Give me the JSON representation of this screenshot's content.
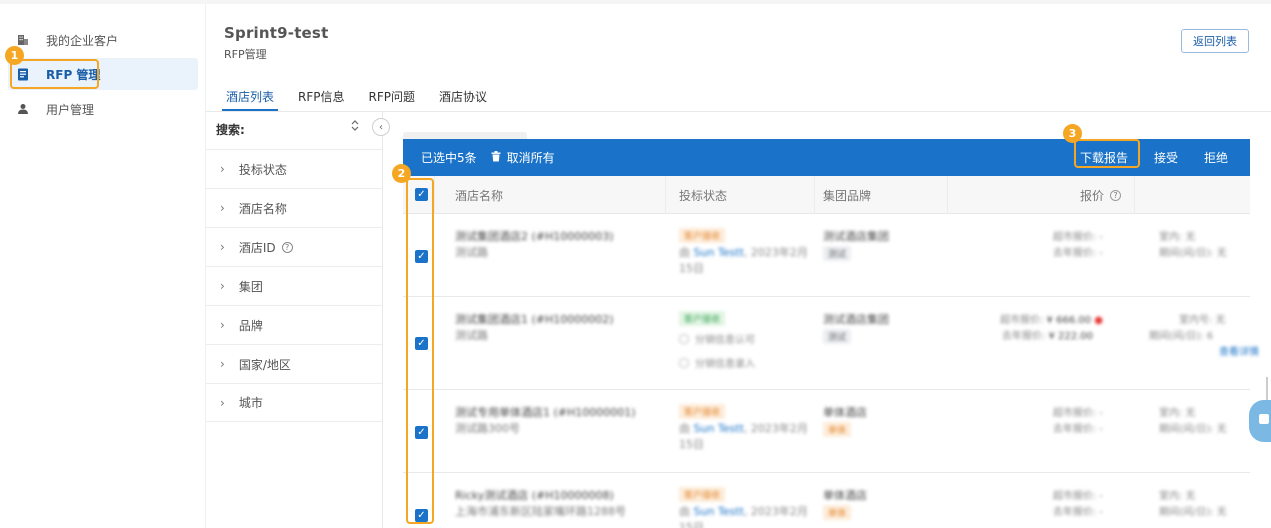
{
  "sidebar": {
    "items": [
      {
        "label": "我的企业客户",
        "icon": "building-icon"
      },
      {
        "label": "RFP 管理",
        "icon": "document-icon",
        "active": true
      },
      {
        "label": "用户管理",
        "icon": "user-icon"
      }
    ]
  },
  "header": {
    "title": "Sprint9-test",
    "subtitle": "RFP管理",
    "back_button": "返回列表"
  },
  "tabs": [
    {
      "label": "酒店列表",
      "active": true
    },
    {
      "label": "RFP信息"
    },
    {
      "label": "RFP问题"
    },
    {
      "label": "酒店协议"
    }
  ],
  "filter": {
    "title": "搜索:",
    "items": [
      {
        "label": "投标状态"
      },
      {
        "label": "酒店名称"
      },
      {
        "label": "酒店ID",
        "help": "?"
      },
      {
        "label": "集团"
      },
      {
        "label": "品牌"
      },
      {
        "label": "国家/地区"
      },
      {
        "label": "城市"
      }
    ]
  },
  "bulk_bar": {
    "selected_text": "已选中5条",
    "clear_label": "取消所有",
    "actions": {
      "download": "下载报告",
      "accept": "接受",
      "reject": "拒绝"
    }
  },
  "table": {
    "headers": {
      "name": "酒店名称",
      "status": "投标状态",
      "brand": "集团品牌",
      "price": "报价"
    },
    "rows": [
      {
        "name": "测试集团酒店2 (#H10000003)",
        "address": "测试路",
        "status": "客户接收",
        "status_style": "orange",
        "by_prefix": "由",
        "by_user": "Sun Testt",
        "by_date": ", 2023年2月",
        "by_date2": "15日",
        "group": "测试酒店集团",
        "brand_tag": "测试",
        "price1": "超市报价: -",
        "price2": "去年报价: -",
        "extra1": "室内: 无",
        "extra2": "期间(间/日): 无"
      },
      {
        "name": "测试集团酒店1 (#H10000002)",
        "address": "测试路",
        "status": "客户接收",
        "status_style": "green",
        "radio1": "分销信息认可",
        "radio2": "分销信息录入",
        "group": "测试酒店集团",
        "brand_tag": "测试",
        "price1_label": "超市报价:",
        "price1_value": "¥ 666.00",
        "price1_flag": "●",
        "price2_label": "去年报价:",
        "price2_value": "¥ 222.00",
        "extra1": "室内号: 无",
        "extra2": "期间(间/日): 6",
        "extra_link": "查看详情"
      },
      {
        "name": "测试专用单体酒店1 (#H10000001)",
        "address": "测试路300号",
        "status": "客户接收",
        "status_style": "orange",
        "by_prefix": "由",
        "by_user": "Sun Testt",
        "by_date": ", 2023年2月",
        "by_date2": "15日",
        "group": "单体酒店",
        "brand_tag": "单体",
        "price1": "超市报价: -",
        "price2": "去年报价: -",
        "extra1": "室内: 无",
        "extra2": "期间(间/日): 无"
      },
      {
        "name": "Ricky测试酒店 (#H10000008)",
        "address": "上海市浦东新区陆家嘴环路1288号",
        "status": "客户接收",
        "status_style": "orange",
        "by_prefix": "由",
        "by_user": "Sun Testt",
        "by_date": ", 2023年2月",
        "by_date2": "15日",
        "group": "单体酒店",
        "brand_tag": "单体",
        "price1": "超市报价: -",
        "price2": "去年报价: -",
        "extra1": "室内: 无",
        "extra2": "期间(间/日): 无"
      }
    ]
  },
  "callouts": [
    "1",
    "2",
    "3"
  ],
  "colors": {
    "accent": "#1a73c8",
    "highlight": "#f5a623",
    "active_bg": "#eaf2fb"
  }
}
